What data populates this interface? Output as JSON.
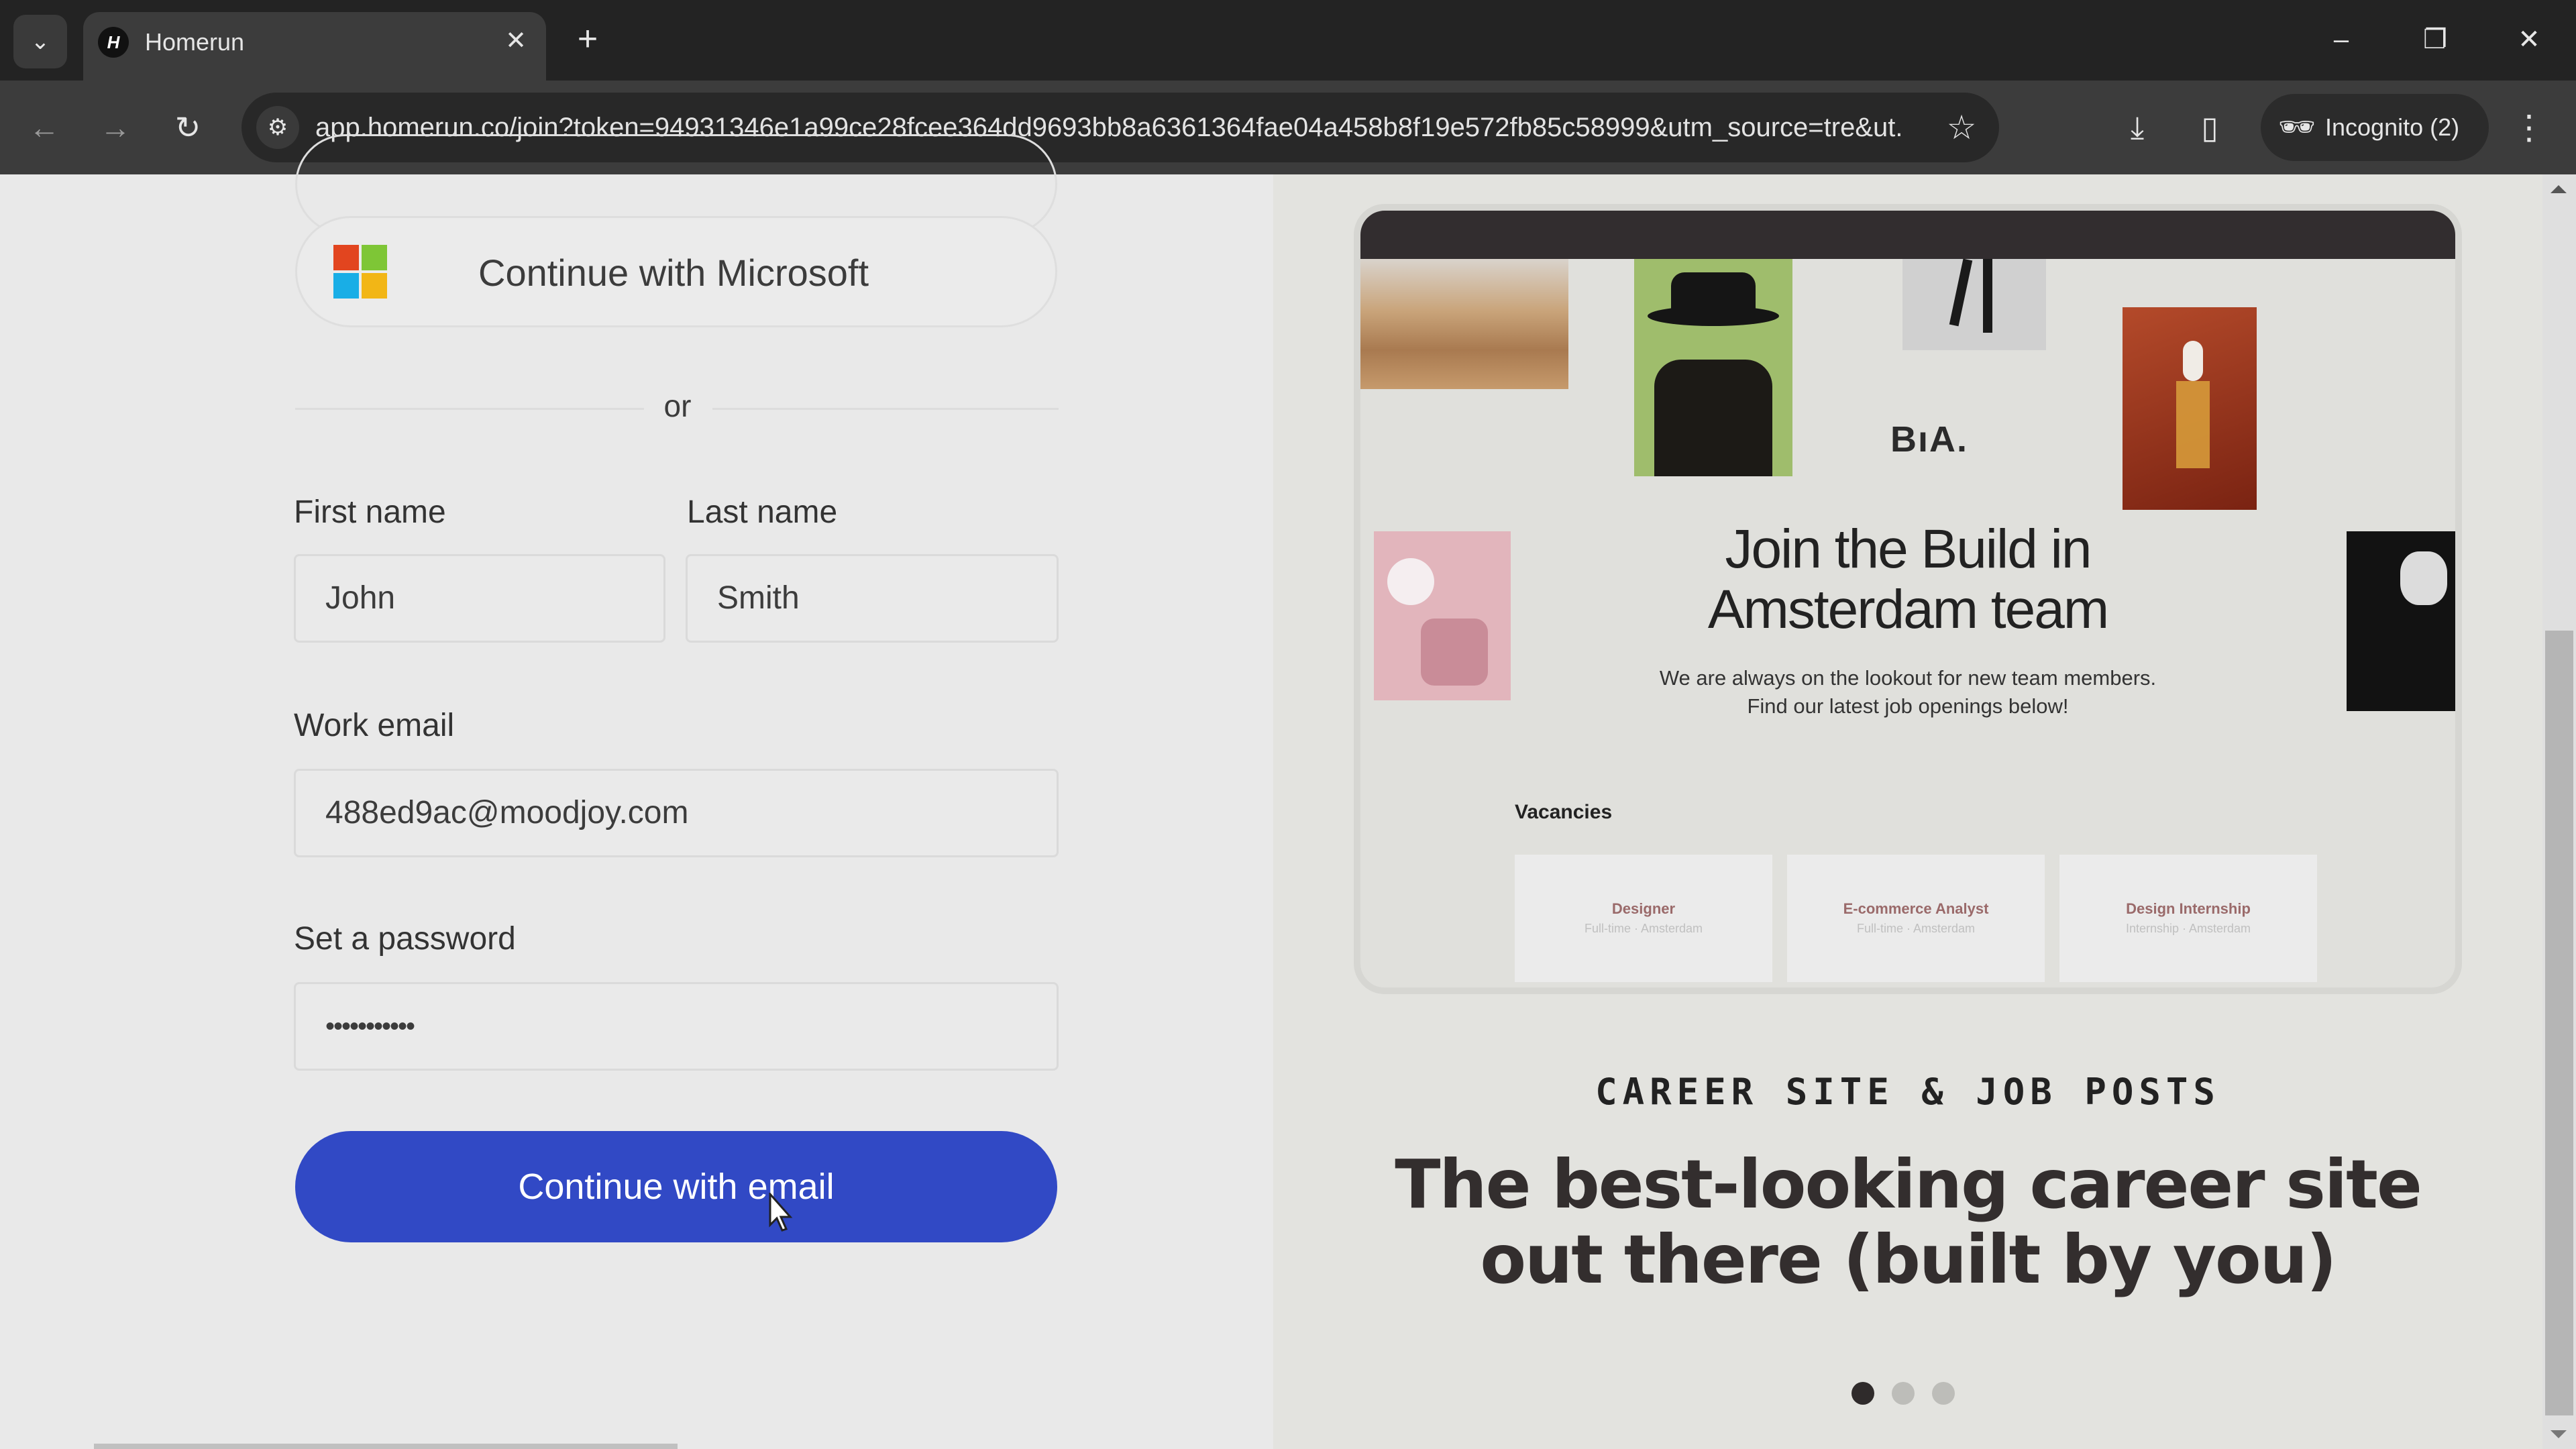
{
  "browser": {
    "tab_title": "Homerun",
    "tab_favicon": "H",
    "url": "app.homerun.co/join?token=94931346e1a99ce28fcee364dd9693bb8a6361364fae04a458b8f19e572fb85c58999&utm_source=tre&ut...",
    "incognito_label": "Incognito (2)",
    "icons": {
      "tab_search": "⌄",
      "close": "✕",
      "new_tab": "+",
      "minimize": "–",
      "restore": "❐",
      "window_close": "✕",
      "back": "←",
      "forward": "→",
      "reload": "↻",
      "site_info": "⚙",
      "bookmark": "☆",
      "download": "⤓",
      "side_panel": "▯",
      "incognito": "🕶",
      "menu": "⋮"
    }
  },
  "signup": {
    "microsoft_button": "Continue with Microsoft",
    "divider_text": "or",
    "first_name": {
      "label": "First name",
      "value": "John"
    },
    "last_name": {
      "label": "Last name",
      "value": "Smith"
    },
    "work_email": {
      "label": "Work email",
      "value": "488ed9ac@moodjoy.com"
    },
    "password": {
      "label": "Set a password",
      "masked_value": "•••••••••••"
    },
    "submit_button": "Continue with email",
    "colors": {
      "primary": "#3149c5",
      "ms_red": "#e2451f",
      "ms_green": "#7ec636",
      "ms_blue": "#19aee6",
      "ms_yellow": "#f2b616"
    }
  },
  "promo": {
    "preview": {
      "brand": "BıA.",
      "title_line1": "Join the Build in",
      "title_line2": "Amsterdam team",
      "subtitle_line1": "We are always on the lookout for new team members.",
      "subtitle_line2": "Find our latest job openings below!",
      "vacancies_label": "Vacancies",
      "vacancies": [
        {
          "title": "Designer",
          "meta": "Full-time · Amsterdam"
        },
        {
          "title": "E-commerce Analyst",
          "meta": "Full-time · Amsterdam"
        },
        {
          "title": "Design Internship",
          "meta": "Internship · Amsterdam"
        }
      ]
    },
    "eyebrow": "CAREER SITE & JOB POSTS",
    "headline_line1": "The best-looking career site",
    "headline_line2": "out there (built by you)",
    "carousel": {
      "total": 3,
      "active_index": 0
    }
  }
}
